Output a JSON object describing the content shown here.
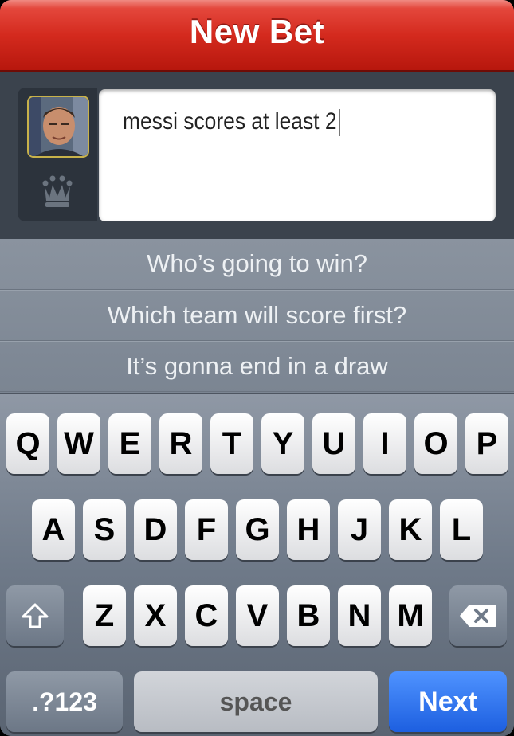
{
  "header": {
    "title": "New Bet"
  },
  "compose": {
    "text_value": "messi scores at least 2",
    "avatar_icon": "user-avatar-photo",
    "crown_icon": "crown-icon"
  },
  "suggestions": [
    {
      "label": "Who’s going to win?"
    },
    {
      "label": "Which team will score first?"
    },
    {
      "label": "It’s gonna end in a draw"
    }
  ],
  "keyboard": {
    "row1": [
      "Q",
      "W",
      "E",
      "R",
      "T",
      "Y",
      "U",
      "I",
      "O",
      "P"
    ],
    "row2": [
      "A",
      "S",
      "D",
      "F",
      "G",
      "H",
      "J",
      "K",
      "L"
    ],
    "row3": [
      "Z",
      "X",
      "C",
      "V",
      "B",
      "N",
      "M"
    ],
    "shift_icon": "shift-arrow-icon",
    "delete_icon": "backspace-icon",
    "mode_label": ".?123",
    "space_label": "space",
    "next_label": "Next"
  }
}
